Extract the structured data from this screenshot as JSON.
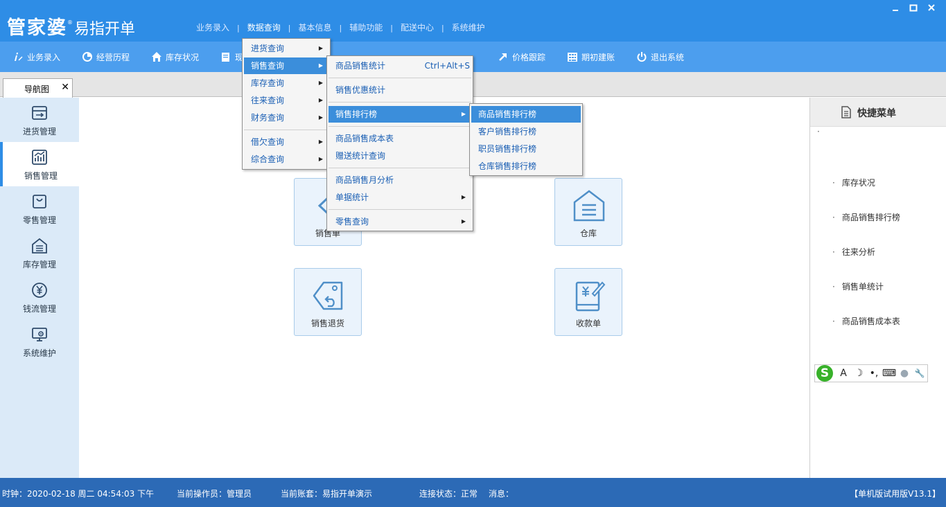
{
  "app": {
    "brand": "管家婆",
    "registered_mark": "®",
    "product": "易指开单"
  },
  "top_menu": [
    "业务录入",
    "数据查询",
    "基本信息",
    "辅助功能",
    "配送中心",
    "系统维护"
  ],
  "top_menu_separator": "|",
  "toolbar": [
    {
      "label": "业务录入",
      "icon": "pen-icon"
    },
    {
      "label": "经营历程",
      "icon": "pie-chart-icon"
    },
    {
      "label": "库存状况",
      "icon": "house-icon"
    },
    {
      "label": "现",
      "icon": "document-icon"
    },
    {
      "label": "价格跟踪",
      "icon": "arrow-up-right-icon"
    },
    {
      "label": "期初建账",
      "icon": "calculator-icon"
    },
    {
      "label": "退出系统",
      "icon": "power-icon"
    }
  ],
  "tabs": [
    {
      "label": "导航图",
      "close": "✕"
    }
  ],
  "sidebar": [
    {
      "label": "进货管理",
      "icon": "purchase-icon"
    },
    {
      "label": "销售管理",
      "icon": "sales-chart-icon",
      "active": true
    },
    {
      "label": "零售管理",
      "icon": "shopping-bag-icon"
    },
    {
      "label": "库存管理",
      "icon": "warehouse-icon"
    },
    {
      "label": "钱流管理",
      "icon": "yuan-icon"
    },
    {
      "label": "系统维护",
      "icon": "monitor-gear-icon"
    }
  ],
  "cards": [
    {
      "label": "销售单",
      "icon": "chevron-left-icon"
    },
    {
      "label": "仓库",
      "icon": "warehouse-icon"
    },
    {
      "label": "销售退货",
      "icon": "tag-return-icon"
    },
    {
      "label": "收款单",
      "icon": "receipt-icon"
    }
  ],
  "quick_menu": {
    "title": "快捷菜单",
    "top_dot": "·",
    "bullet": "·",
    "items": [
      "库存状况",
      "商品销售排行榜",
      "往来分析",
      "销售单统计",
      "商品销售成本表"
    ]
  },
  "ime_bar": {
    "logo": "S",
    "glyphs": [
      "A",
      "☽",
      "•,",
      "⌨",
      "●",
      "🔧"
    ]
  },
  "data_query_menu": {
    "groups": [
      [
        {
          "label": "进货查询",
          "submenu": true
        },
        {
          "label": "销售查询",
          "submenu": true,
          "highlighted": true
        },
        {
          "label": "库存查询",
          "submenu": true
        },
        {
          "label": "往来查询",
          "submenu": true
        },
        {
          "label": "财务查询",
          "submenu": true
        }
      ],
      [
        {
          "label": "借欠查询",
          "submenu": true
        },
        {
          "label": "综合查询",
          "submenu": true
        }
      ]
    ]
  },
  "sales_query_menu": {
    "groups": [
      [
        {
          "label": "商品销售统计",
          "shortcut": "Ctrl+Alt+S"
        }
      ],
      [
        {
          "label": "销售优惠统计"
        }
      ],
      [
        {
          "label": "销售排行榜",
          "submenu": true,
          "highlighted": true
        }
      ],
      [
        {
          "label": "商品销售成本表"
        },
        {
          "label": "赠送统计查询"
        }
      ],
      [
        {
          "label": "商品销售月分析"
        },
        {
          "label": "单据统计",
          "submenu": true
        }
      ],
      [
        {
          "label": "零售查询",
          "submenu": true
        }
      ]
    ]
  },
  "ranking_menu": {
    "items": [
      {
        "label": "商品销售排行榜",
        "highlighted": true
      },
      {
        "label": "客户销售排行榜"
      },
      {
        "label": "职员销售排行榜"
      },
      {
        "label": "仓库销售排行榜"
      }
    ]
  },
  "submenu_arrow": "▶",
  "status_bar": {
    "clock": "时钟：2020-02-18 周二 04:54:03 下午",
    "operator": "当前操作员：管理员",
    "account": "当前账套：易指开单演示",
    "connection": "连接状态：正常",
    "message": "消息：",
    "version": "【单机版试用版V13.1】"
  },
  "colors": {
    "title_bar": "#2e8de6",
    "toolbar": "#4c9eee",
    "sidebar": "#dbeaf8",
    "status_bar": "#2c6ab6",
    "menu_highlight": "#3b8edb",
    "menu_text": "#1a5fb4"
  }
}
